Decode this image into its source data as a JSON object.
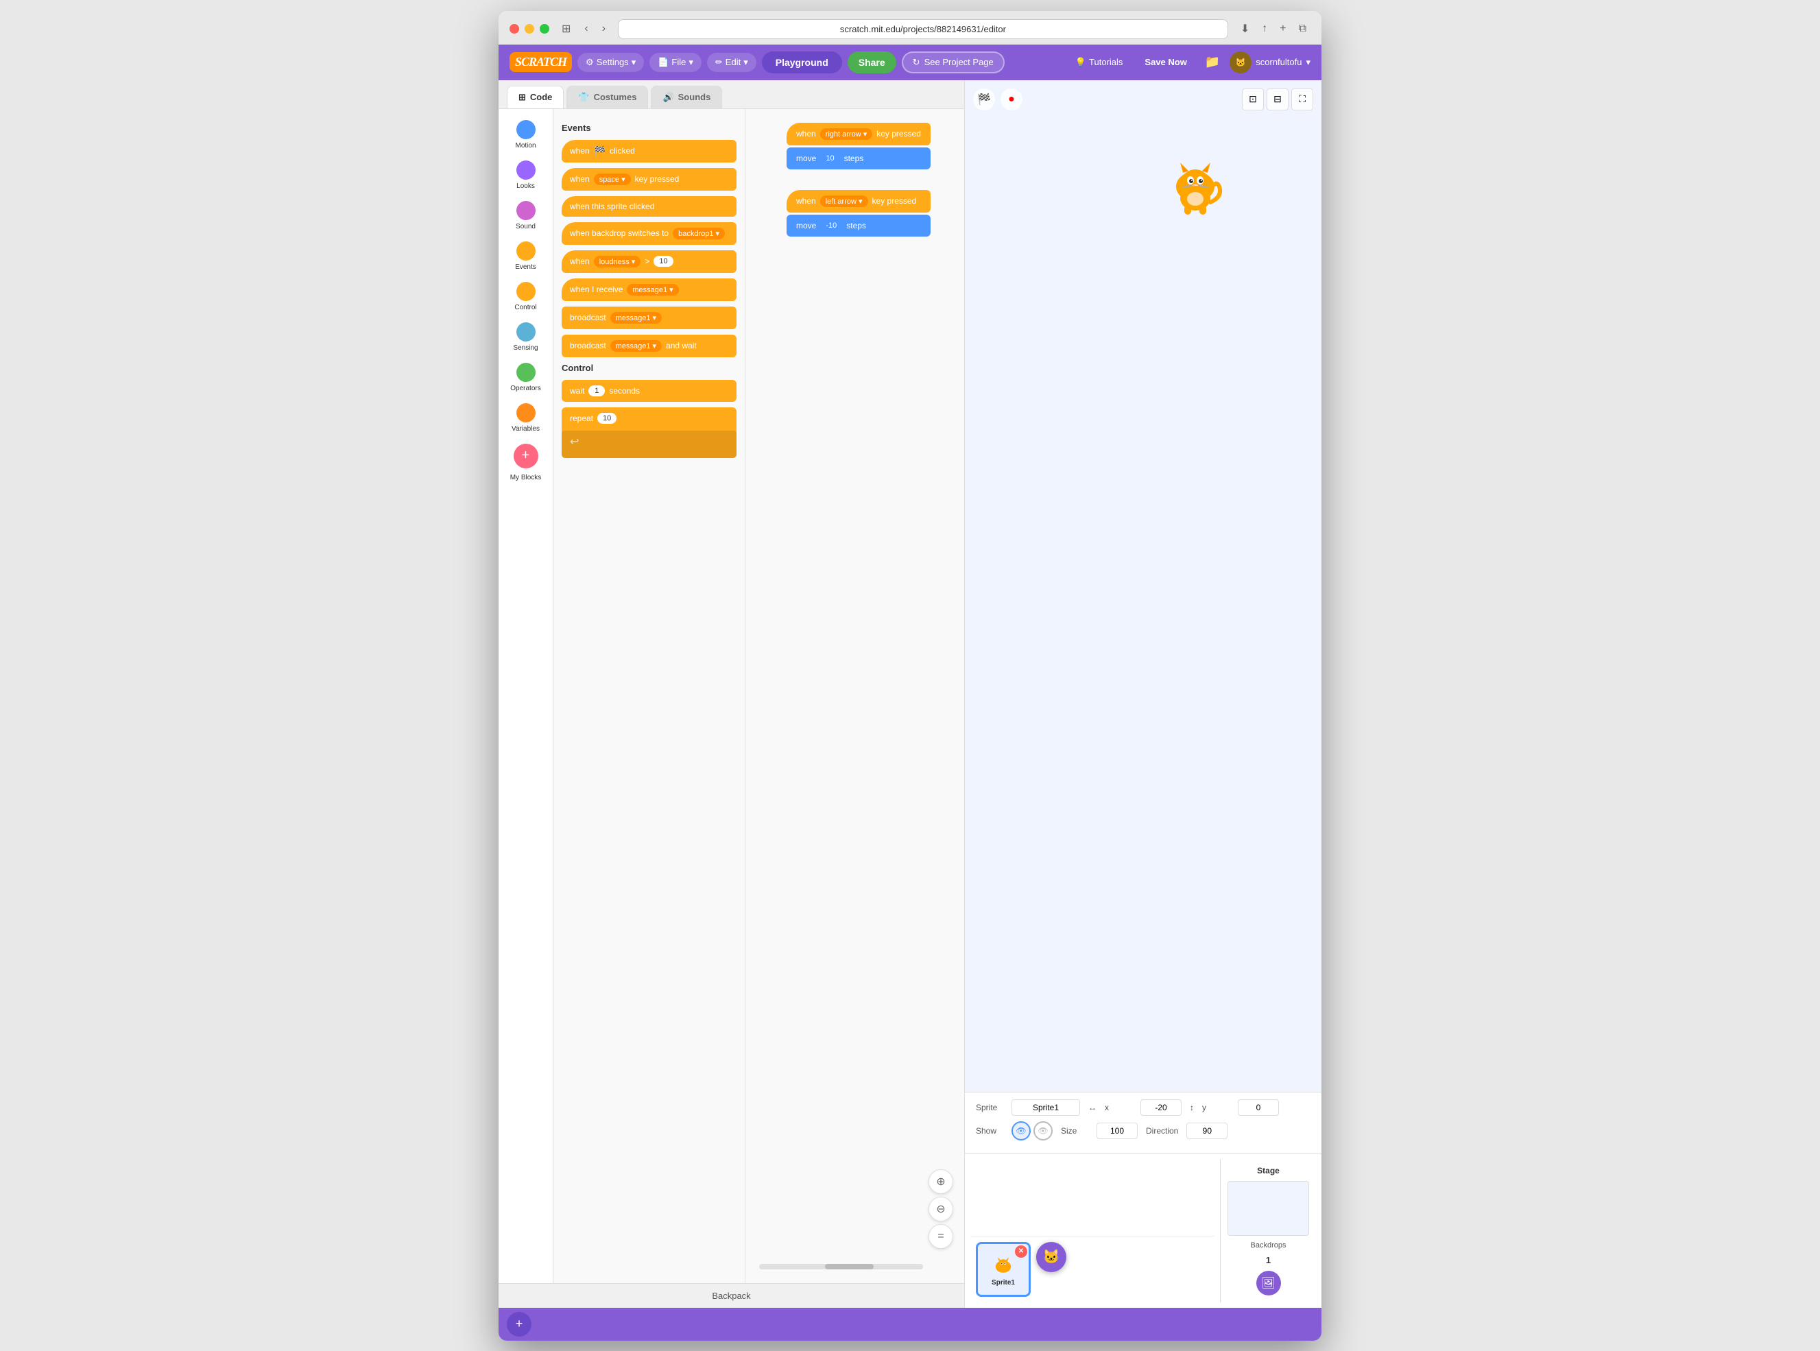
{
  "browser": {
    "url": "scratch.mit.edu/projects/882149631/editor",
    "reload_label": "↻"
  },
  "header": {
    "logo": "SCRATCH",
    "settings_label": "Settings",
    "file_label": "File",
    "edit_label": "Edit",
    "playground_label": "Playground",
    "share_label": "Share",
    "see_project_label": "See Project Page",
    "tutorials_label": "Tutorials",
    "save_now_label": "Save Now",
    "user_label": "scornfultofu"
  },
  "tabs": {
    "code_label": "Code",
    "costumes_label": "Costumes",
    "sounds_label": "Sounds"
  },
  "categories": [
    {
      "id": "motion",
      "label": "Motion",
      "color": "#4c97ff"
    },
    {
      "id": "looks",
      "label": "Looks",
      "color": "#9966ff"
    },
    {
      "id": "sound",
      "label": "Sound",
      "color": "#cf63cf"
    },
    {
      "id": "events",
      "label": "Events",
      "color": "#ffab19"
    },
    {
      "id": "control",
      "label": "Control",
      "color": "#ffab19"
    },
    {
      "id": "sensing",
      "label": "Sensing",
      "color": "#5cb1d6"
    },
    {
      "id": "operators",
      "label": "Operators",
      "color": "#59c059"
    },
    {
      "id": "variables",
      "label": "Variables",
      "color": "#ff8c1a"
    },
    {
      "id": "my_blocks",
      "label": "My Blocks",
      "color": "#ff6680"
    }
  ],
  "events_blocks": [
    {
      "id": "when_flag",
      "text": "when",
      "suffix": "clicked",
      "hasFlag": true
    },
    {
      "id": "when_key",
      "text": "when",
      "key": "space",
      "suffix": "key pressed"
    },
    {
      "id": "when_sprite",
      "text": "when this sprite clicked"
    },
    {
      "id": "when_backdrop",
      "text": "when backdrop switches to",
      "value": "backdrop1"
    },
    {
      "id": "when_loudness",
      "text": "when",
      "sensor": "loudness",
      "op": ">",
      "value": "10"
    },
    {
      "id": "when_receive",
      "text": "when I receive",
      "value": "message1"
    },
    {
      "id": "broadcast",
      "text": "broadcast",
      "value": "message1"
    },
    {
      "id": "broadcast_wait",
      "text": "broadcast",
      "value": "message1",
      "suffix": "and wait"
    }
  ],
  "control_section": {
    "title": "Control",
    "blocks": [
      {
        "id": "wait",
        "text": "wait",
        "value": "1",
        "suffix": "seconds"
      },
      {
        "id": "repeat",
        "text": "repeat",
        "value": "10"
      }
    ]
  },
  "script_groups": [
    {
      "id": "right_arrow",
      "trigger_text": "when",
      "key": "right arrow",
      "suffix": "key pressed",
      "action_text": "move",
      "steps": "10",
      "steps_suffix": "steps"
    },
    {
      "id": "left_arrow",
      "trigger_text": "when",
      "key": "left arrow",
      "suffix": "key pressed",
      "action_text": "move",
      "steps": "-10",
      "steps_suffix": "steps"
    }
  ],
  "stage": {
    "sprite_label": "Sprite",
    "sprite_name": "Sprite1",
    "x_label": "x",
    "x_value": "-20",
    "y_label": "y",
    "y_value": "0",
    "show_label": "Show",
    "size_label": "Size",
    "size_value": "100",
    "direction_label": "Direction",
    "direction_value": "90"
  },
  "sprite_list": [
    {
      "id": "sprite1",
      "name": "Sprite1"
    }
  ],
  "stage_panel": {
    "label": "Stage",
    "backdrops_label": "Backdrops",
    "backdrops_count": "1"
  },
  "backpack": {
    "label": "Backpack"
  },
  "zoom": {
    "in_label": "⊕",
    "out_label": "⊖",
    "reset_label": "="
  }
}
